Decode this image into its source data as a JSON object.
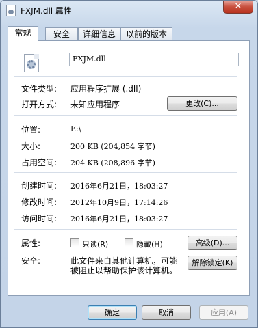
{
  "window": {
    "title": "FXJM.dll 属性",
    "close_glyph": "✕"
  },
  "tabs": [
    {
      "label": "常规"
    },
    {
      "label": "安全"
    },
    {
      "label": "详细信息"
    },
    {
      "label": "以前的版本"
    }
  ],
  "general": {
    "file_name": "FXJM.dll",
    "file_type_label": "文件类型:",
    "file_type_value": "应用程序扩展 (.dll)",
    "open_with_label": "打开方式:",
    "open_with_value": "未知应用程序",
    "change_button": "更改(C)...",
    "location_label": "位置:",
    "location_value": "E:\\",
    "size_label": "大小:",
    "size_value": "200 KB (204,854 字节)",
    "size_on_disk_label": "占用空间:",
    "size_on_disk_value": "204 KB (208,896 字节)",
    "created_label": "创建时间:",
    "created_value": "2016年6月21日，18:03:27",
    "modified_label": "修改时间:",
    "modified_value": "2012年10月9日，17:14:26",
    "accessed_label": "访问时间:",
    "accessed_value": "2016年6月21日，18:03:27",
    "attributes_label": "属性:",
    "readonly_label": "只读(R)",
    "hidden_label": "隐藏(H)",
    "advanced_button": "高级(D)...",
    "security_label": "安全:",
    "security_text_line1": "此文件来自其他计算机，可能",
    "security_text_line2": "被阻止以帮助保护该计算机。",
    "unblock_button": "解除锁定(K)"
  },
  "buttons": {
    "ok": "确定",
    "cancel": "取消",
    "apply": "应用(A)"
  }
}
